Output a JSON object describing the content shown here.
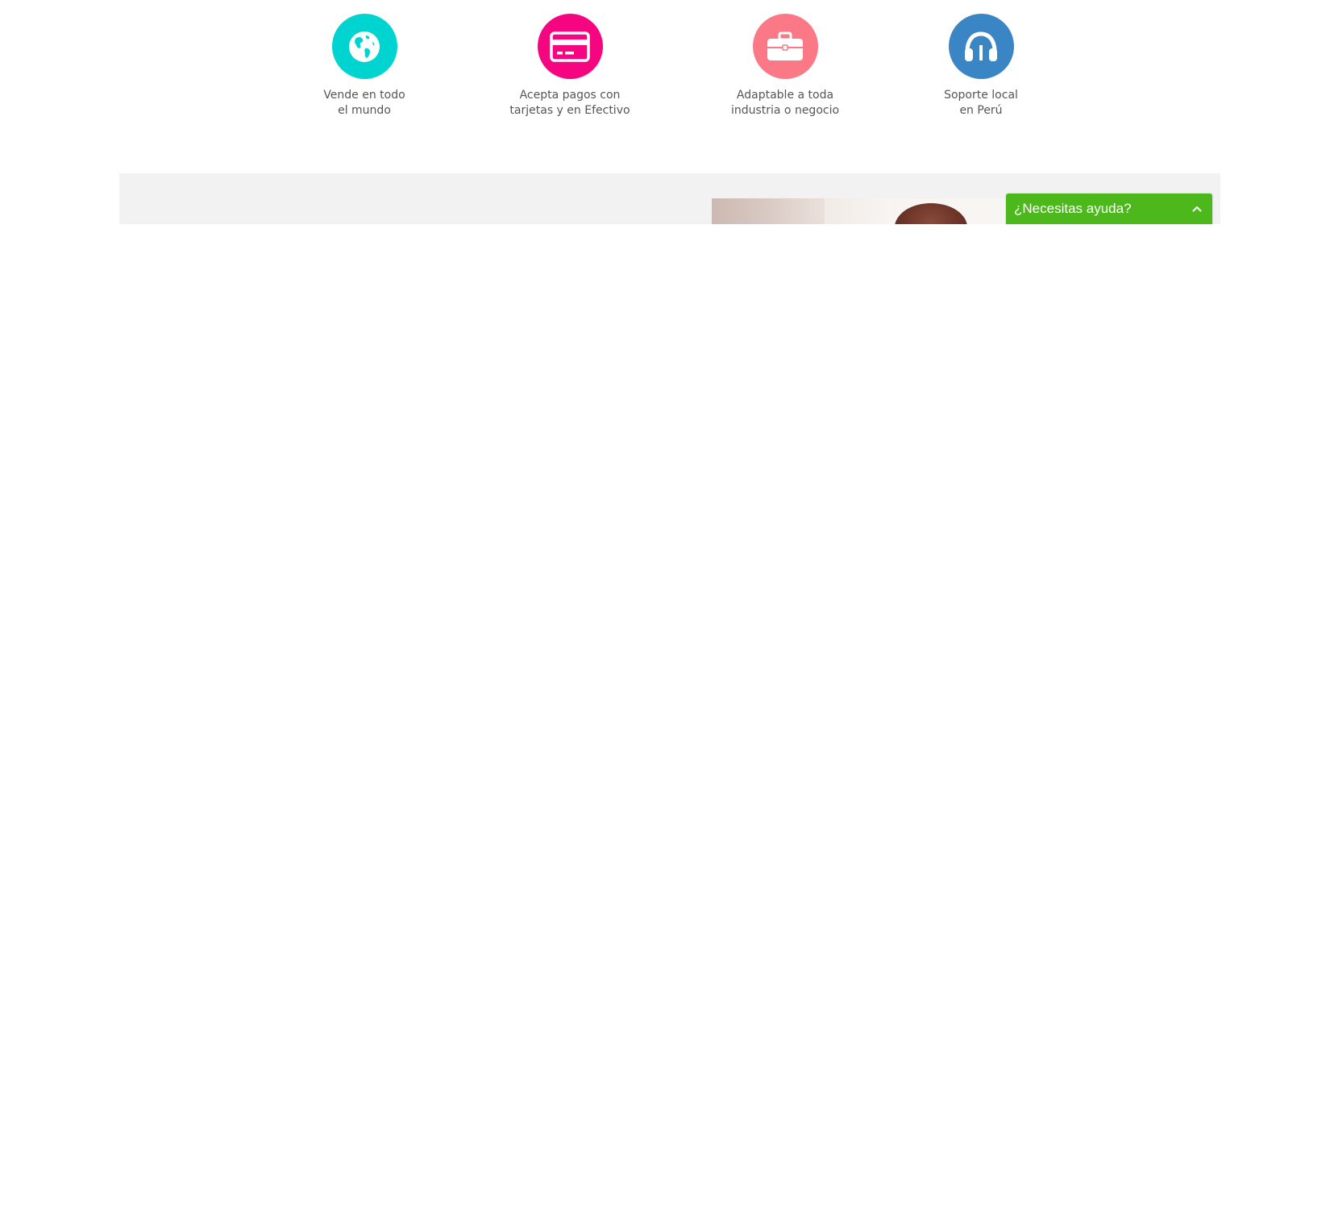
{
  "features": [
    {
      "icon": "globe-icon",
      "color": "#00d4d0",
      "line1": "Vende en todo",
      "line2": "el mundo"
    },
    {
      "icon": "credit-card-icon",
      "color": "#f5057f",
      "line1": "Acepta pagos con",
      "line2": "tarjetas y en Efectivo"
    },
    {
      "icon": "briefcase-icon",
      "color": "#fb7887",
      "line1": "Adaptable a toda",
      "line2": "industria o negocio"
    },
    {
      "icon": "headset-icon",
      "color": "#3a86c4",
      "line1": "Soporte local",
      "line2": "en Perú"
    }
  ],
  "help_widget": {
    "label": "¿Necesitas ayuda?",
    "icon": "chevron-up-icon",
    "color": "#4cb81c"
  },
  "band": {
    "color": "#f2f2f2"
  }
}
